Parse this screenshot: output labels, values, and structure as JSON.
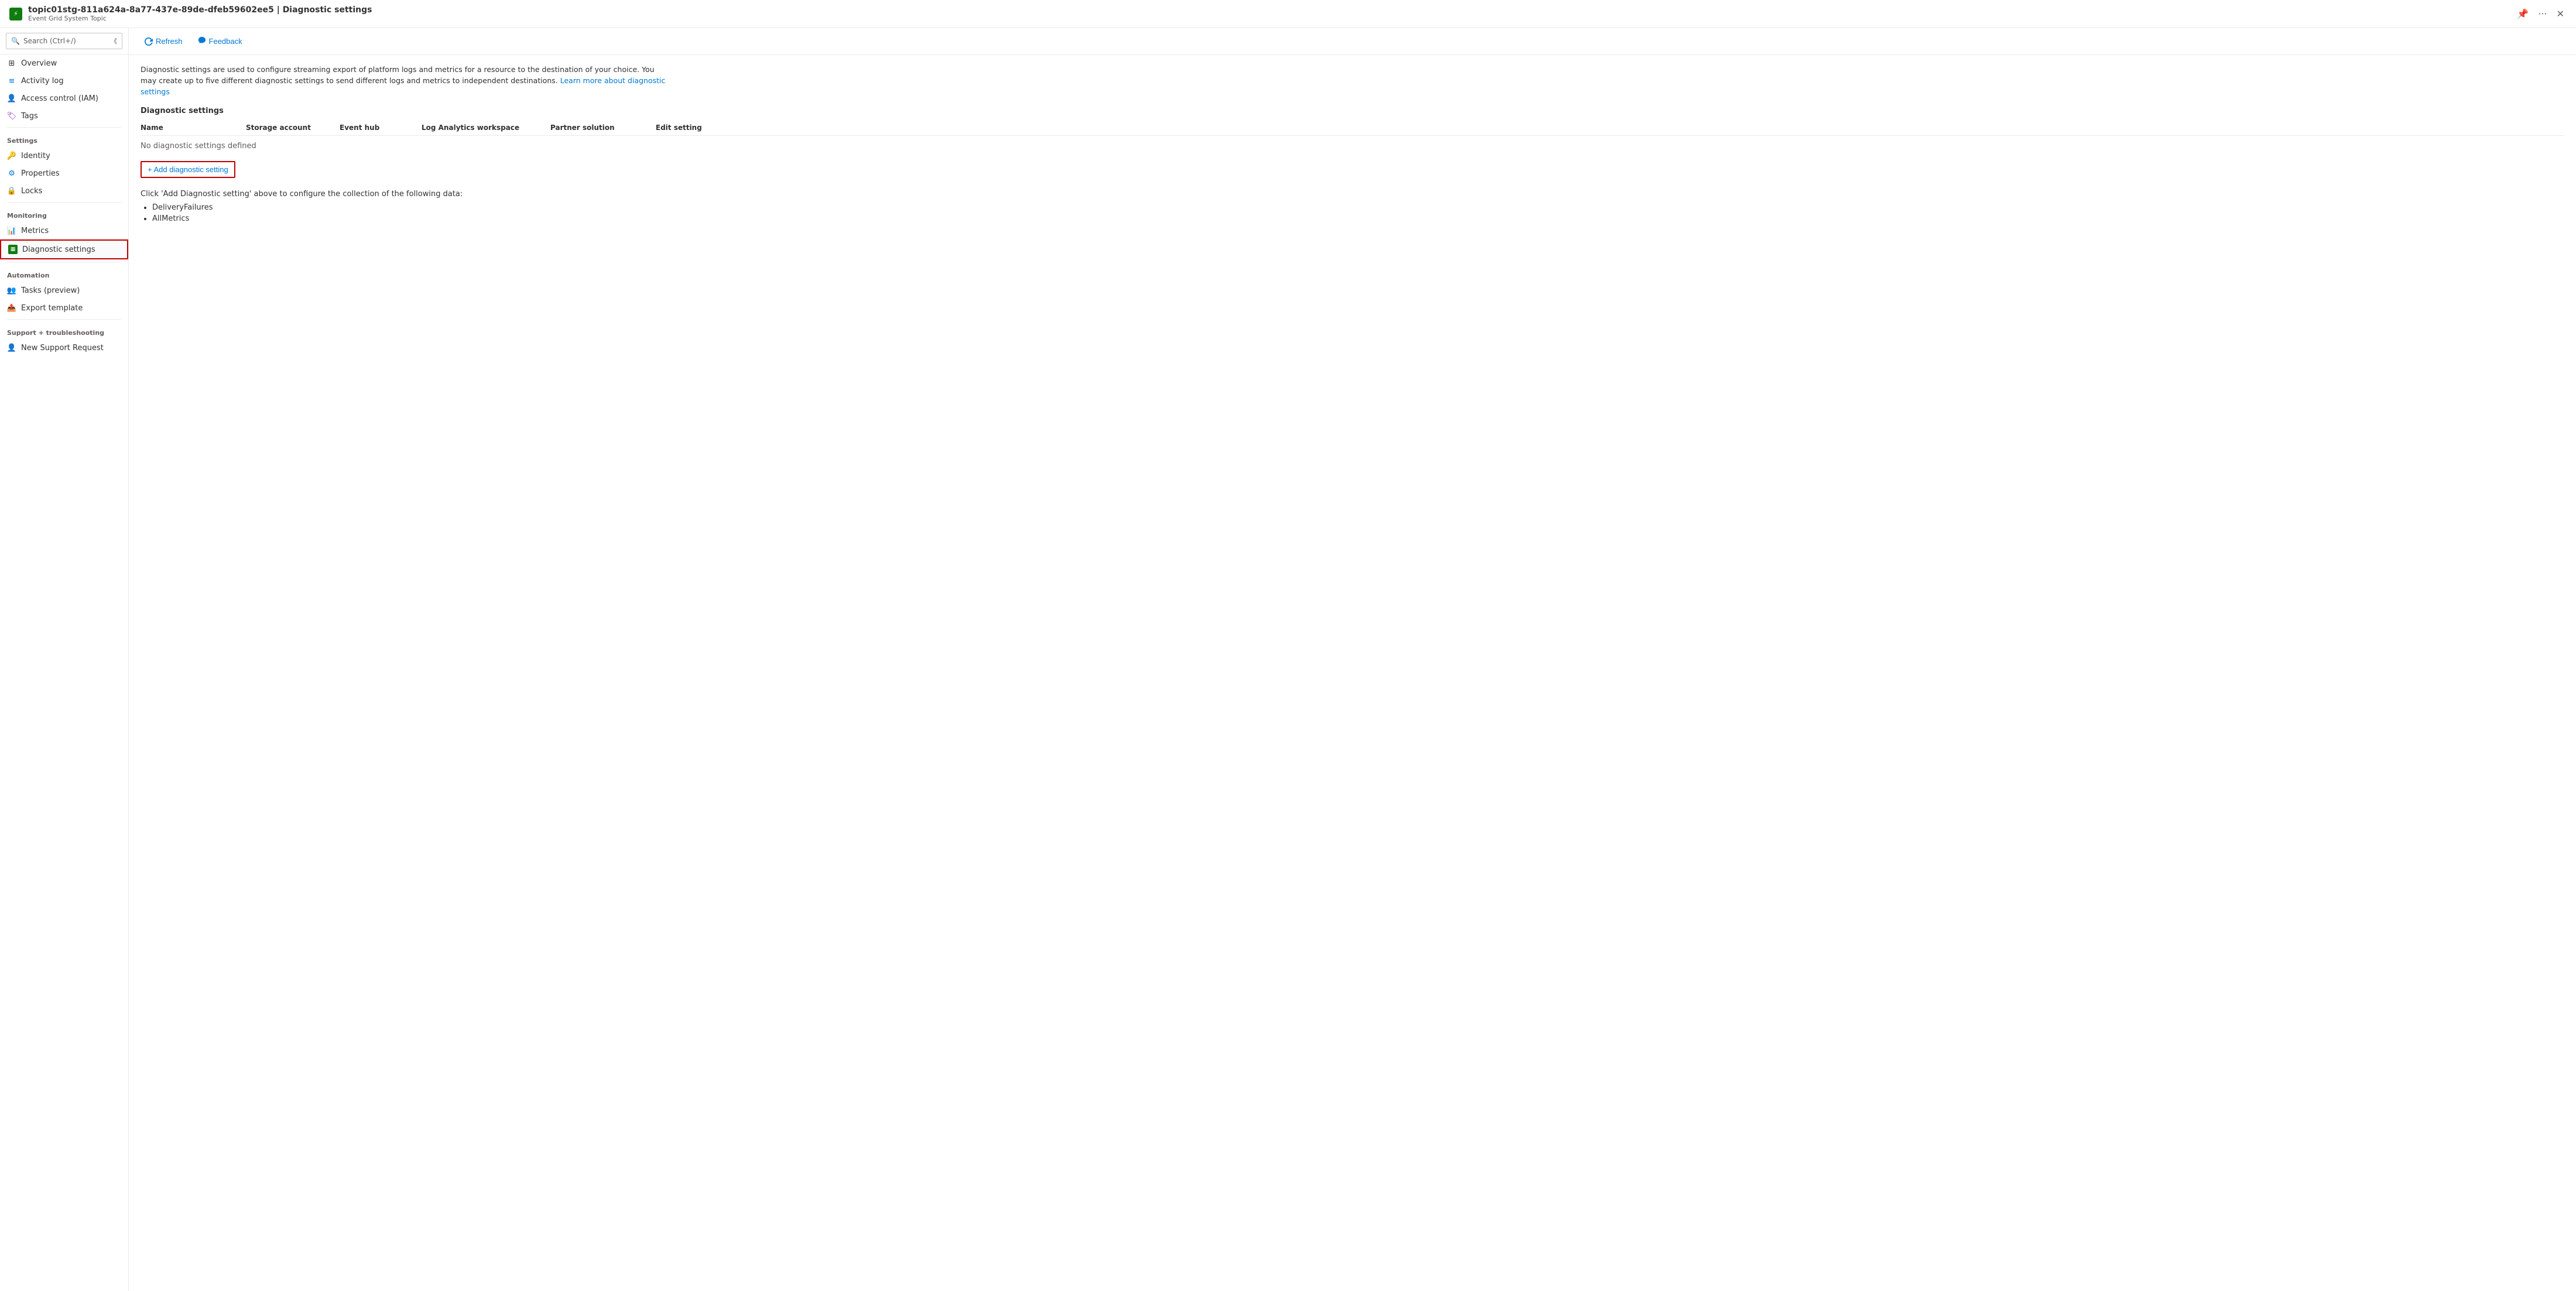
{
  "header": {
    "resource_id": "topic01stg-811a624a-8a77-437e-89de-dfeb59602ee5",
    "separator": "|",
    "page_title": "Diagnostic settings",
    "resource_type": "Event Grid System Topic"
  },
  "toolbar": {
    "refresh_label": "Refresh",
    "feedback_label": "Feedback"
  },
  "search": {
    "placeholder": "Search (Ctrl+/)"
  },
  "sidebar": {
    "nav_items": [
      {
        "id": "overview",
        "label": "Overview",
        "icon": "grid"
      },
      {
        "id": "activity-log",
        "label": "Activity log",
        "icon": "list"
      },
      {
        "id": "access-control",
        "label": "Access control (IAM)",
        "icon": "person"
      },
      {
        "id": "tags",
        "label": "Tags",
        "icon": "tag"
      }
    ],
    "settings_section": "Settings",
    "settings_items": [
      {
        "id": "identity",
        "label": "Identity",
        "icon": "key"
      },
      {
        "id": "properties",
        "label": "Properties",
        "icon": "sliders"
      },
      {
        "id": "locks",
        "label": "Locks",
        "icon": "lock"
      }
    ],
    "monitoring_section": "Monitoring",
    "monitoring_items": [
      {
        "id": "metrics",
        "label": "Metrics",
        "icon": "chart"
      },
      {
        "id": "diagnostic-settings",
        "label": "Diagnostic settings",
        "icon": "diagnostic",
        "active": true
      }
    ],
    "automation_section": "Automation",
    "automation_items": [
      {
        "id": "tasks-preview",
        "label": "Tasks (preview)",
        "icon": "tasks"
      },
      {
        "id": "export-template",
        "label": "Export template",
        "icon": "export"
      }
    ],
    "support_section": "Support + troubleshooting",
    "support_items": [
      {
        "id": "new-support-request",
        "label": "New Support Request",
        "icon": "support"
      }
    ]
  },
  "content": {
    "description_part1": "Diagnostic settings are used to configure streaming export of platform logs and metrics for a resource to the destination of your choice. You may create up to five different diagnostic settings to send different logs and metrics to independent destinations.",
    "description_link_text": "Learn more about diagnostic settings",
    "section_title": "Diagnostic settings",
    "table_columns": {
      "name": "Name",
      "storage_account": "Storage account",
      "event_hub": "Event hub",
      "log_analytics_workspace": "Log Analytics workspace",
      "partner_solution": "Partner solution",
      "edit_setting": "Edit setting"
    },
    "no_settings_message": "No diagnostic settings defined",
    "add_button_label": "+ Add diagnostic setting",
    "click_instruction": "Click 'Add Diagnostic setting' above to configure the collection of the following data:",
    "data_items": [
      "DeliveryFailures",
      "AllMetrics"
    ]
  }
}
